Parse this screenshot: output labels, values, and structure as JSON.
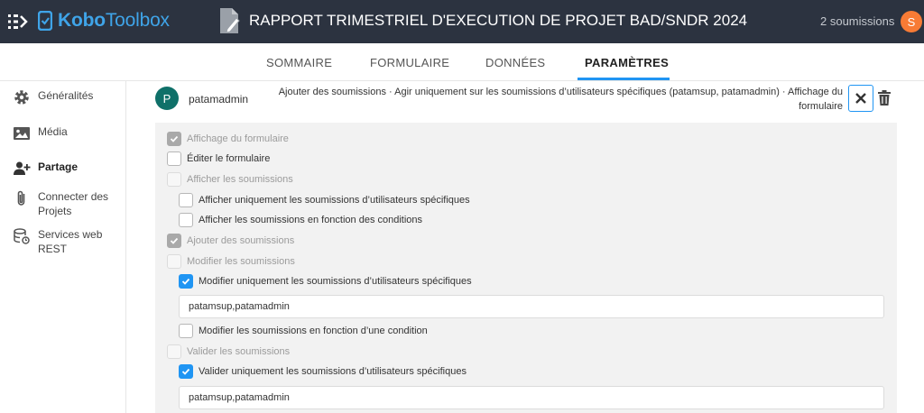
{
  "header": {
    "logo_text_bold": "Kobo",
    "logo_text_light": "Toolbox",
    "project_title": "RAPPORT TRIMESTRIEL D'EXECUTION DE PROJET BAD/SNDR 2024",
    "submission_count": "2 soumissions",
    "user_initial": "S"
  },
  "tabs": [
    {
      "label": "SOMMAIRE"
    },
    {
      "label": "FORMULAIRE"
    },
    {
      "label": "DONNÉES"
    },
    {
      "label": "PARAMÈTRES",
      "active": true
    }
  ],
  "sidebar": {
    "items": [
      {
        "label": "Généralités",
        "icon": "gear-icon"
      },
      {
        "label": "Média",
        "icon": "image-icon"
      },
      {
        "label": "Partage",
        "icon": "add-user-icon",
        "active": true
      },
      {
        "label": "Connecter des Projets",
        "icon": "paperclip-icon"
      },
      {
        "label": "Services web REST",
        "icon": "database-icon"
      }
    ]
  },
  "permission": {
    "user_initial": "P",
    "username": "patamadmin",
    "summary": "Ajouter des soumissions · Agir uniquement sur les soumissions d’utilisateurs spécifiques (patamsup, patamadmin) · Affichage du formulaire"
  },
  "options": [
    {
      "label": "Affichage du formulaire",
      "state": "checked-disabled"
    },
    {
      "label": "Éditer le formulaire",
      "state": "unchecked"
    },
    {
      "label": "Afficher les soumissions",
      "state": "empty-disabled"
    },
    {
      "label": "Afficher uniquement les soumissions d’utilisateurs spécifiques",
      "state": "unchecked"
    },
    {
      "label": "Afficher les soumissions en fonction des conditions",
      "state": "unchecked"
    },
    {
      "label": "Ajouter des soumissions",
      "state": "checked-disabled"
    },
    {
      "label": "Modifier les soumissions",
      "state": "empty-disabled"
    },
    {
      "label": "Modifier uniquement les soumissions d’utilisateurs spécifiques",
      "state": "checked"
    },
    {
      "label": "Modifier les soumissions en fonction d’une condition",
      "state": "unchecked"
    },
    {
      "label": "Valider les soumissions",
      "state": "empty-disabled"
    },
    {
      "label": "Valider uniquement les soumissions d’utilisateurs spécifiques",
      "state": "checked"
    }
  ],
  "inputs": {
    "modify_users": "patamsup,patamadmin",
    "validate_users": "patamsup,patamadmin"
  },
  "colors": {
    "topbar": "#2c3340",
    "accent": "#2095f3",
    "user_avatar": "#0f7069",
    "account_avatar": "#f77b35"
  }
}
